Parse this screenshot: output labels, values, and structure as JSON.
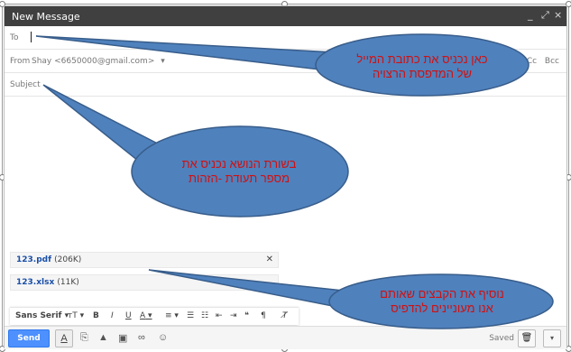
{
  "window": {
    "title": "New Message",
    "controls": [
      "_",
      "⤢",
      "×"
    ]
  },
  "to": {
    "label": "To"
  },
  "from": {
    "label": "From",
    "value": "Shay <6650000@gmail.com>",
    "dropdown": "▾",
    "cc": "Cc",
    "bcc": "Bcc"
  },
  "subject": {
    "label": "Subject"
  },
  "attachments": [
    {
      "name": "123.pdf",
      "size": "(206K)"
    },
    {
      "name": "123.xlsx",
      "size": "(11K)"
    }
  ],
  "format_toolbar": {
    "font": "Sans Serif",
    "size": "тT",
    "items": [
      "B",
      "I",
      "U",
      "A",
      "≡",
      "☰",
      "☷",
      "⇤",
      "⇥",
      "❝",
      "¶",
      "T̸"
    ]
  },
  "bottom_bar": {
    "send": "Send",
    "saved": "Saved",
    "more": "▾"
  },
  "callouts": [
    {
      "lines": [
        "כאן נכניס את כתובת המייל",
        "של המדפסת הרצויה"
      ]
    },
    {
      "lines": [
        "בשורת הנושא נכניס את",
        "מספר תעודת -הזהות"
      ]
    },
    {
      "lines": [
        "נוסיף את הקבצים שאותם",
        "אנו מעוניינים להדפיס"
      ]
    }
  ],
  "colors": {
    "titlebar": "#404040",
    "send_button": "#4d90fe",
    "callout_fill": "#4f81bd",
    "callout_text": "#d01010"
  }
}
